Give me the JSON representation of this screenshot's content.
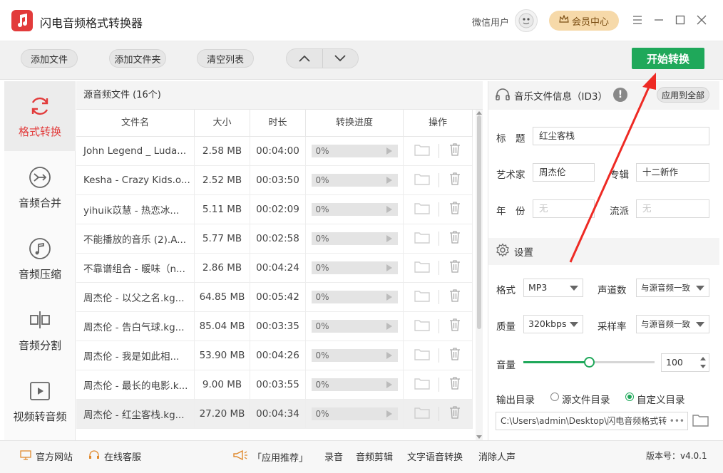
{
  "app": {
    "title": "闪电音频格式转换器",
    "user_label": "微信用户",
    "vip_label": "会员中心",
    "accent": "#1fa85a",
    "brand_red": "#e23b3b"
  },
  "toolbar": {
    "add_file": "添加文件",
    "add_folder": "添加文件夹",
    "clear_list": "清空列表",
    "start": "开始转换"
  },
  "sidebar": {
    "items": [
      {
        "label": "格式转换",
        "icon": "refresh-icon"
      },
      {
        "label": "音频合并",
        "icon": "merge-icon"
      },
      {
        "label": "音频压缩",
        "icon": "music-note-icon"
      },
      {
        "label": "音频分割",
        "icon": "split-icon"
      },
      {
        "label": "视频转音频",
        "icon": "play-video-icon"
      }
    ]
  },
  "files": {
    "title": "源音频文件 (16个)",
    "columns": [
      "文件名",
      "大小",
      "时长",
      "转换进度",
      "操作"
    ],
    "rows": [
      {
        "name": "John Legend _ Luda...",
        "size": "2.58 MB",
        "duration": "00:04:00",
        "progress": "0%",
        "progress_value": 0
      },
      {
        "name": "Kesha - Crazy Kids.o...",
        "size": "2.52 MB",
        "duration": "00:03:50",
        "progress": "0%",
        "progress_value": 0
      },
      {
        "name": "yihuik苡慧 - 热恋冰...",
        "size": "5.11 MB",
        "duration": "00:02:09",
        "progress": "0%",
        "progress_value": 0
      },
      {
        "name": "不能播放的音乐 (2).A...",
        "size": "5.77 MB",
        "duration": "00:02:58",
        "progress": "0%",
        "progress_value": 0
      },
      {
        "name": "不靠谱组合 - 暖味（n...",
        "size": "2.86 MB",
        "duration": "00:04:24",
        "progress": "0%",
        "progress_value": 0
      },
      {
        "name": "周杰伦 - 以父之名.kg...",
        "size": "64.85 MB",
        "duration": "00:05:42",
        "progress": "0%",
        "progress_value": 0
      },
      {
        "name": "周杰伦 - 告白气球.kg...",
        "size": "85.04 MB",
        "duration": "00:03:35",
        "progress": "0%",
        "progress_value": 0
      },
      {
        "name": "周杰伦 - 我是如此相...",
        "size": "53.90 MB",
        "duration": "00:04:26",
        "progress": "0%",
        "progress_value": 0
      },
      {
        "name": "周杰伦 - 最长的电影.k...",
        "size": "9.00 MB",
        "duration": "00:03:55",
        "progress": "0%",
        "progress_value": 0
      },
      {
        "name": "周杰伦 - 红尘客栈.kg...",
        "size": "27.20 MB",
        "duration": "00:04:34",
        "progress": "0%",
        "progress_value": 0
      }
    ]
  },
  "id3": {
    "title": "音乐文件信息（ID3）",
    "apply_all": "应用到全部",
    "title_label": "标　题",
    "title_value": "红尘客栈",
    "artist_label": "艺术家",
    "artist_value": "周杰伦",
    "album_label": "专辑",
    "album_value": "十二新作",
    "year_label": "年　份",
    "year_value": "无",
    "genre_label": "流派",
    "genre_value": "无"
  },
  "settings": {
    "title": "设置",
    "format_label": "格式",
    "format_value": "MP3",
    "channels_label": "声道数",
    "channels_value": "与源音频一致",
    "quality_label": "质量",
    "quality_value": "320kbps",
    "samplerate_label": "采样率",
    "samplerate_value": "与源音频一致",
    "volume_label": "音量",
    "volume_value": "100",
    "volume_fraction": 0.5,
    "output_label": "输出目录",
    "output_source": "源文件目录",
    "output_custom": "自定义目录",
    "output_path": "C:\\Users\\admin\\Desktop\\闪电音频格式转"
  },
  "footer": {
    "website": "官方网站",
    "support": "在线客服",
    "recommend": "「应用推荐」",
    "record": "录音",
    "edit": "音频剪辑",
    "tts": "文字语音转换",
    "vocal_remove": "消除人声",
    "version": "版本号：v4.0.1"
  }
}
